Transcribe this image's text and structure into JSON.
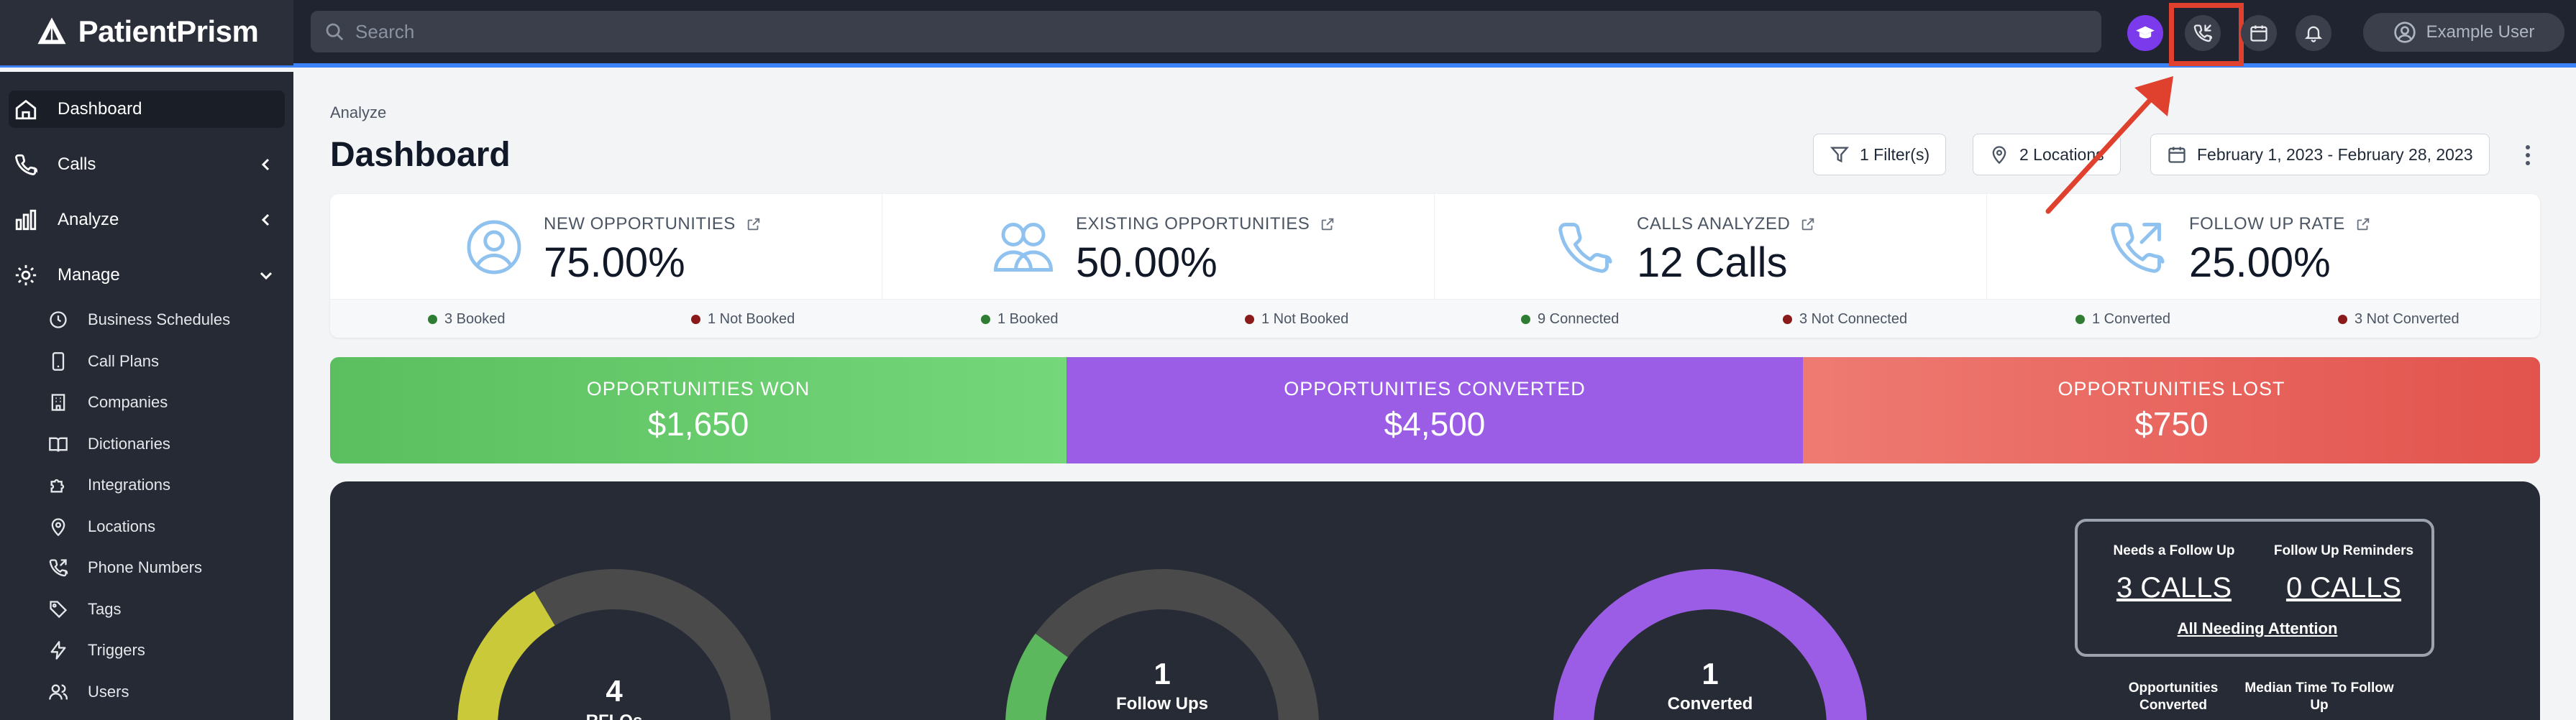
{
  "app": {
    "name": "PatientPrism",
    "brand_color": "#3b82f6"
  },
  "search": {
    "placeholder": "Search"
  },
  "topbar": {
    "icons": [
      "graduation-cap-icon",
      "phone-callback-icon",
      "calendar-icon",
      "bell-icon"
    ],
    "user_name": "Example User"
  },
  "sidebar": {
    "items": [
      {
        "label": "Dashboard",
        "icon": "home-icon",
        "active": true
      },
      {
        "label": "Calls",
        "icon": "phone-icon",
        "chevron": "left"
      },
      {
        "label": "Analyze",
        "icon": "bar-chart-icon",
        "chevron": "left"
      },
      {
        "label": "Manage",
        "icon": "gear-icon",
        "chevron": "down"
      }
    ],
    "manage_items": [
      {
        "label": "Business Schedules",
        "icon": "clock-icon"
      },
      {
        "label": "Call Plans",
        "icon": "phone-device-icon"
      },
      {
        "label": "Companies",
        "icon": "building-icon"
      },
      {
        "label": "Dictionaries",
        "icon": "book-icon"
      },
      {
        "label": "Integrations",
        "icon": "puzzle-icon"
      },
      {
        "label": "Locations",
        "icon": "map-pin-icon"
      },
      {
        "label": "Phone Numbers",
        "icon": "phone-arrow-icon"
      },
      {
        "label": "Tags",
        "icon": "tag-icon"
      },
      {
        "label": "Triggers",
        "icon": "lightning-icon"
      },
      {
        "label": "Users",
        "icon": "users-icon"
      }
    ]
  },
  "header": {
    "breadcrumb": "Analyze",
    "title": "Dashboard",
    "filters_label": "1 Filter(s)",
    "locations_label": "2 Locations",
    "date_range": "February 1, 2023 - February 28, 2023"
  },
  "stats": [
    {
      "label": "NEW OPPORTUNITIES",
      "value": "75.00%",
      "icon": "user-circle-icon",
      "foot": [
        {
          "text": "3 Booked",
          "color": "#2e7d32"
        },
        {
          "text": "1 Not Booked",
          "color": "#8b1a1a"
        }
      ]
    },
    {
      "label": "EXISTING OPPORTUNITIES",
      "value": "50.00%",
      "icon": "users-group-icon",
      "foot": [
        {
          "text": "1 Booked",
          "color": "#2e7d32"
        },
        {
          "text": "1 Not Booked",
          "color": "#8b1a1a"
        }
      ]
    },
    {
      "label": "CALLS ANALYZED",
      "value": "12 Calls",
      "icon": "phone-icon",
      "foot": [
        {
          "text": "9 Connected",
          "color": "#2e7d32"
        },
        {
          "text": "3 Not Connected",
          "color": "#8b1a1a"
        }
      ]
    },
    {
      "label": "FOLLOW UP RATE",
      "value": "25.00%",
      "icon": "phone-outgoing-icon",
      "foot": [
        {
          "text": "1 Converted",
          "color": "#2e7d32"
        },
        {
          "text": "3 Not Converted",
          "color": "#8b1a1a"
        }
      ]
    }
  ],
  "opportunities": {
    "won": {
      "label": "OPPORTUNITIES WON",
      "value": "$1,650"
    },
    "converted": {
      "label": "OPPORTUNITIES CONVERTED",
      "value": "$4,500"
    },
    "lost": {
      "label": "OPPORTUNITIES LOST",
      "value": "$750"
    }
  },
  "gauges": [
    {
      "value": "4",
      "label": "RFLOs",
      "fill_fraction": 0.33,
      "color": "#c9c93a"
    },
    {
      "value": "1",
      "label": "Follow Ups",
      "fill_fraction": 0.2,
      "color": "#5cb85c"
    },
    {
      "value": "1",
      "label": "Converted",
      "fill_fraction": 1.0,
      "color": "#9b5de5"
    }
  ],
  "attention": {
    "needs_follow_up_label": "Needs a Follow Up",
    "needs_follow_up_value": "3 CALLS",
    "reminders_label": "Follow Up Reminders",
    "reminders_value": "0 CALLS",
    "link": "All Needing Attention",
    "opps_converted_label": "Opportunities Converted",
    "median_time_label": "Median Time To Follow Up"
  },
  "annotation_color": "#e0412e"
}
